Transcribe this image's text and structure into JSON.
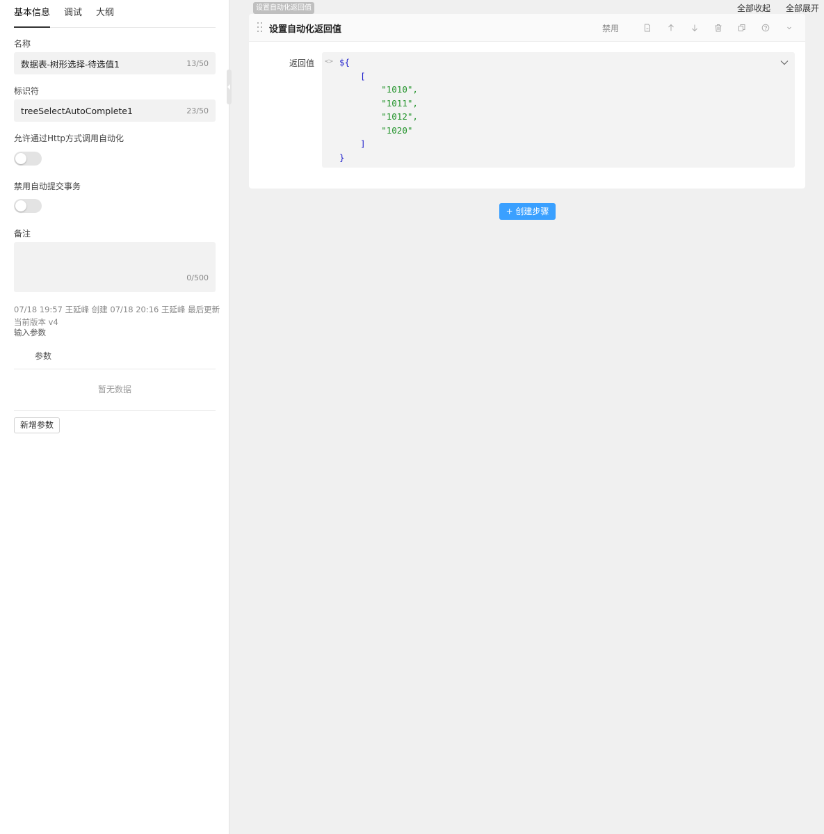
{
  "tabs": [
    {
      "label": "基本信息",
      "active": true
    },
    {
      "label": "调试",
      "active": false
    },
    {
      "label": "大纲",
      "active": false
    }
  ],
  "form": {
    "name_label": "名称",
    "name_value": "数据表-树形选择-待选值1",
    "name_count": "13/50",
    "id_label": "标识符",
    "id_value": "treeSelectAutoComplete1",
    "id_count": "23/50",
    "http_label": "允许通过Http方式调用自动化",
    "http_enabled": false,
    "tx_label": "禁用自动提交事务",
    "tx_enabled": false,
    "remark_label": "备注",
    "remark_count": "0/500"
  },
  "meta": {
    "history": "07/18 19:57 王延峰 创建 07/18 20:16 王延峰 最后更新",
    "version": "当前版本 v4",
    "input_params": "输入参数"
  },
  "params": {
    "column": "参数",
    "empty": "暂无数据",
    "add_label": "新增参数"
  },
  "top_actions": {
    "collapse_all": "全部收起",
    "expand_all": "全部展开"
  },
  "step": {
    "tag": "设置自动化返回值",
    "title": "设置自动化返回值",
    "disable_label": "禁用",
    "return_label": "返回值",
    "code_prefix": "${",
    "code_open": "[",
    "code_items": [
      "\"1010\",",
      "\"1011\",",
      "\"1012\",",
      "\"1020\""
    ],
    "code_close_bracket": "]",
    "code_close_brace": "}"
  },
  "create_step": "+ 创建步骤",
  "colors": {
    "primary": "#3aa0ff",
    "string": "#22932a",
    "code_punct": "#2222cc"
  }
}
